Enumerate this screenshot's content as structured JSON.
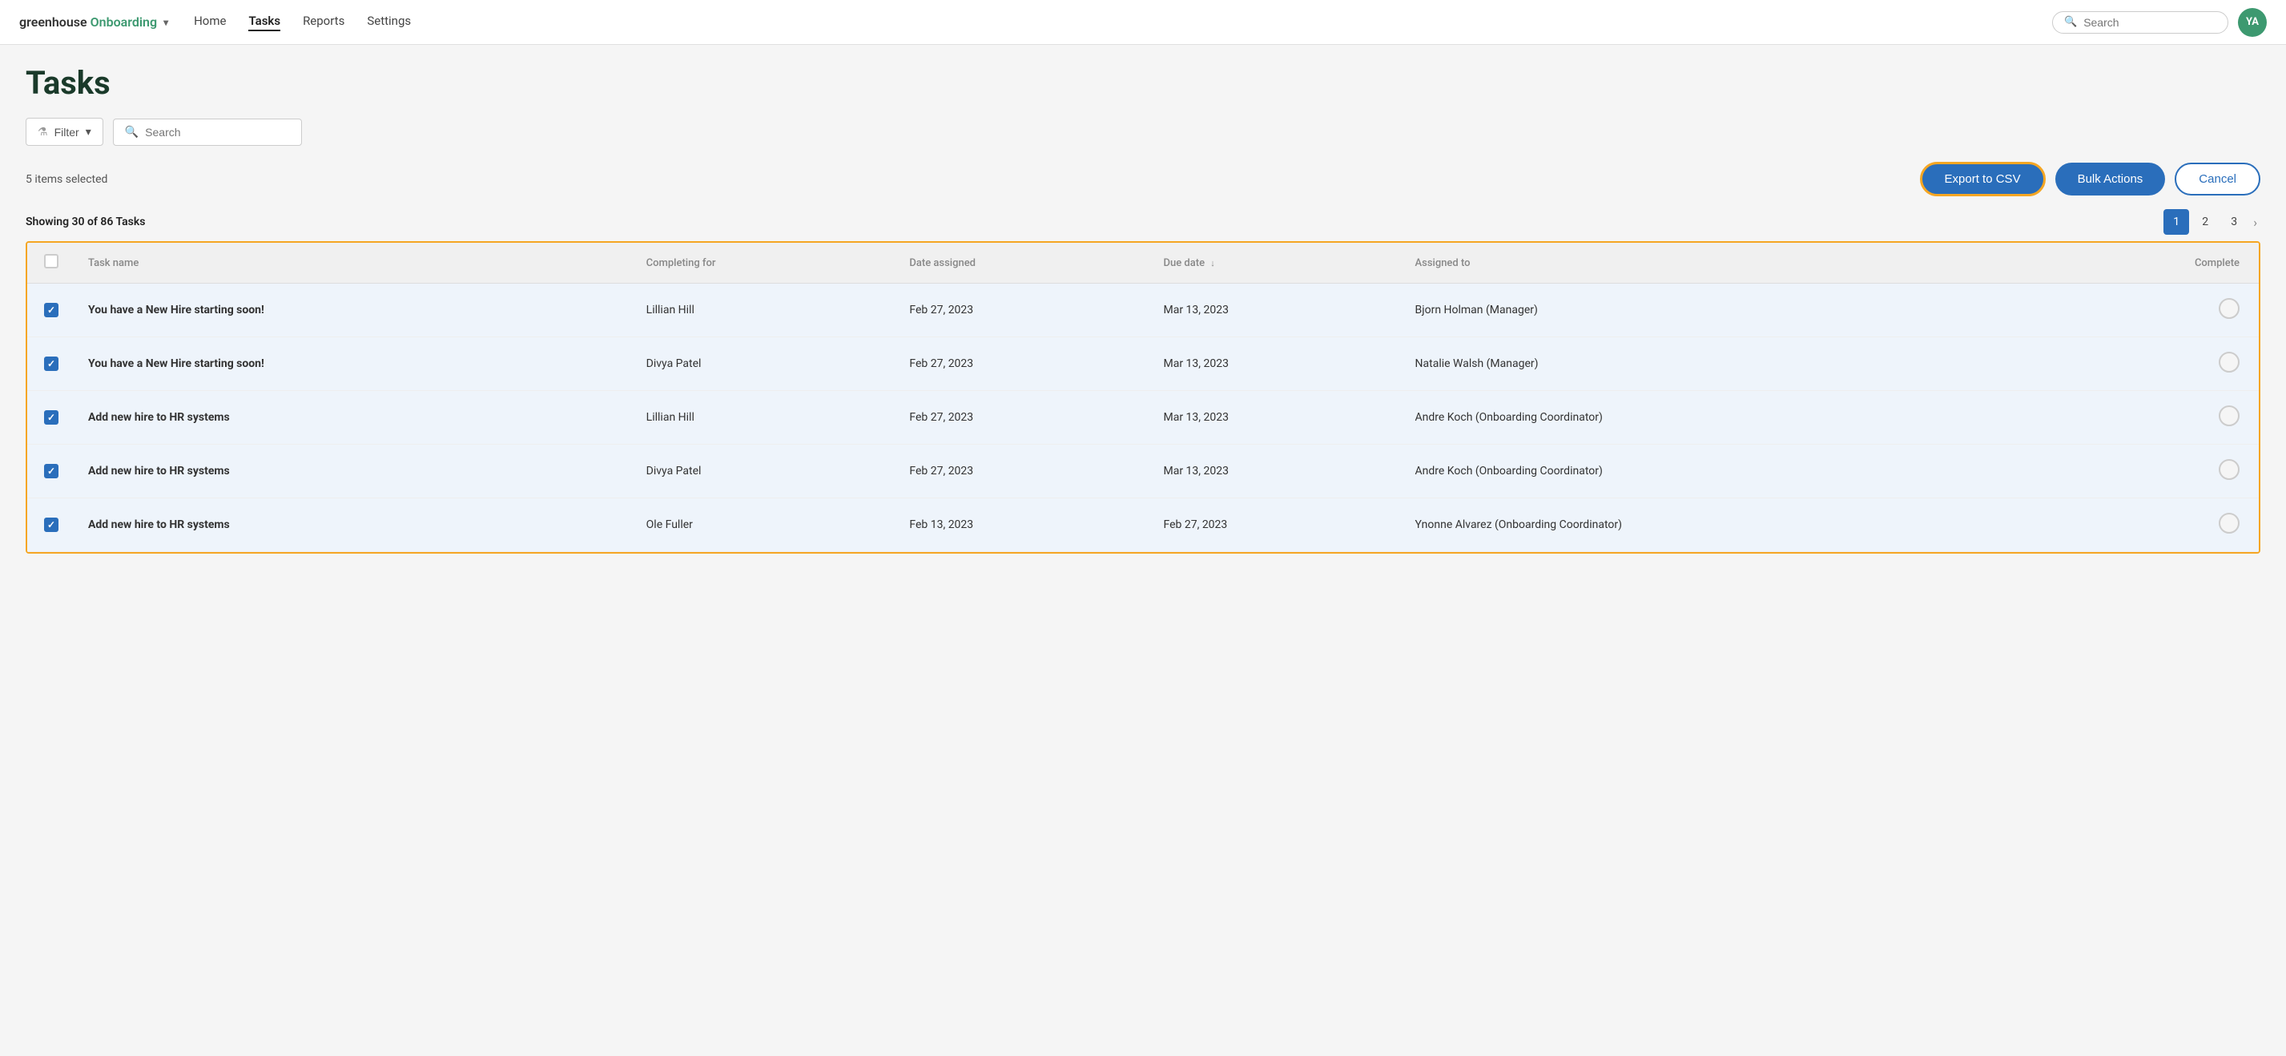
{
  "nav": {
    "logo_text": "greenhouse",
    "logo_green": "Onboarding",
    "links": [
      {
        "label": "Home",
        "active": false
      },
      {
        "label": "Tasks",
        "active": true
      },
      {
        "label": "Reports",
        "active": false
      },
      {
        "label": "Settings",
        "active": false
      }
    ],
    "search_placeholder": "Search",
    "avatar_initials": "YA"
  },
  "page": {
    "title": "Tasks",
    "filter_label": "Filter",
    "search_placeholder": "Search",
    "items_selected": "5 items selected",
    "export_csv_label": "Export to CSV",
    "bulk_actions_label": "Bulk Actions",
    "cancel_label": "Cancel",
    "showing_text": "Showing 30 of 86 Tasks",
    "pagination": {
      "pages": [
        "1",
        "2",
        "3"
      ],
      "active": "1",
      "next_label": "›"
    }
  },
  "table": {
    "columns": [
      {
        "key": "checkbox",
        "label": ""
      },
      {
        "key": "task_name",
        "label": "Task name"
      },
      {
        "key": "completing_for",
        "label": "Completing for"
      },
      {
        "key": "date_assigned",
        "label": "Date assigned"
      },
      {
        "key": "due_date",
        "label": "Due date"
      },
      {
        "key": "assigned_to",
        "label": "Assigned to"
      },
      {
        "key": "complete",
        "label": "Complete"
      }
    ],
    "rows": [
      {
        "id": 1,
        "checked": true,
        "task_name": "You have a New Hire starting soon!",
        "completing_for": "Lillian Hill",
        "date_assigned": "Feb 27, 2023",
        "due_date": "Mar 13, 2023",
        "assigned_to": "Bjorn Holman (Manager)"
      },
      {
        "id": 2,
        "checked": true,
        "task_name": "You have a New Hire starting soon!",
        "completing_for": "Divya Patel",
        "date_assigned": "Feb 27, 2023",
        "due_date": "Mar 13, 2023",
        "assigned_to": "Natalie Walsh (Manager)"
      },
      {
        "id": 3,
        "checked": true,
        "task_name": "Add new hire to HR systems",
        "completing_for": "Lillian Hill",
        "date_assigned": "Feb 27, 2023",
        "due_date": "Mar 13, 2023",
        "assigned_to": "Andre Koch (Onboarding Coordinator)"
      },
      {
        "id": 4,
        "checked": true,
        "task_name": "Add new hire to HR systems",
        "completing_for": "Divya Patel",
        "date_assigned": "Feb 27, 2023",
        "due_date": "Mar 13, 2023",
        "assigned_to": "Andre Koch (Onboarding Coordinator)"
      },
      {
        "id": 5,
        "checked": true,
        "task_name": "Add new hire to HR systems",
        "completing_for": "Ole Fuller",
        "date_assigned": "Feb 13, 2023",
        "due_date": "Feb 27, 2023",
        "assigned_to": "Ynonne Alvarez (Onboarding Coordinator)"
      }
    ]
  }
}
